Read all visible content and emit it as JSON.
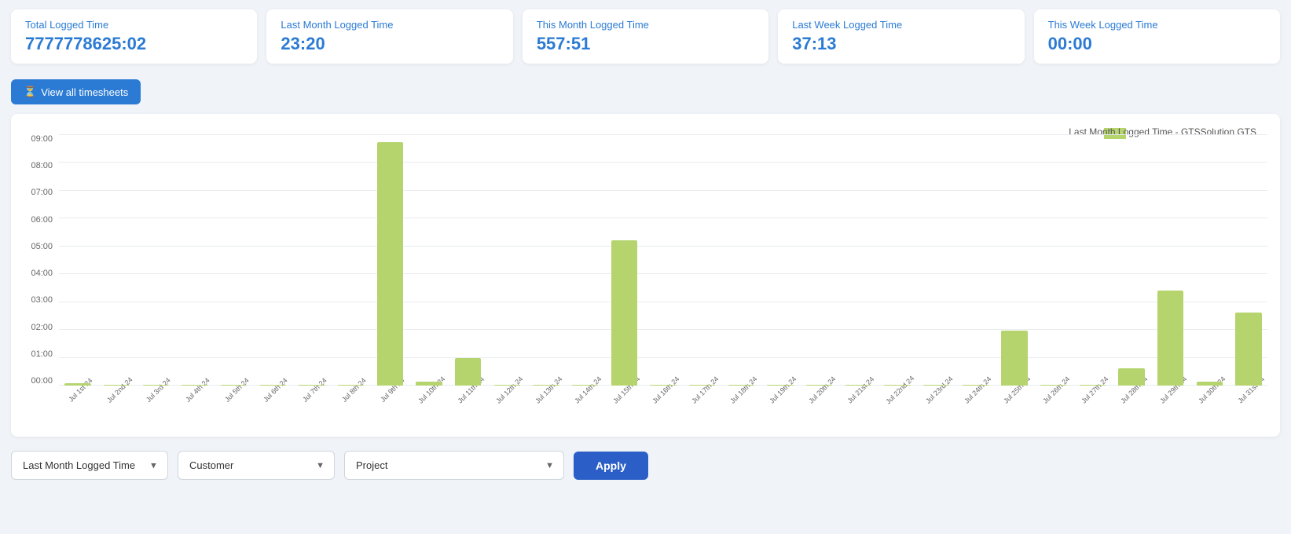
{
  "stats": [
    {
      "label": "Total Logged Time",
      "value": "7777778625:02"
    },
    {
      "label": "Last Month Logged Time",
      "value": "23:20"
    },
    {
      "label": "This Month Logged Time",
      "value": "557:51"
    },
    {
      "label": "Last Week Logged Time",
      "value": "37:13"
    },
    {
      "label": "This Week Logged Time",
      "value": "00:00"
    }
  ],
  "toolbar": {
    "view_all_label": "View all timesheets"
  },
  "chart": {
    "title": "Last Month Logged Time - GTSSolution GTS",
    "y_labels": [
      "09:00",
      "08:00",
      "07:00",
      "06:00",
      "05:00",
      "04:00",
      "03:00",
      "02:00",
      "01:00",
      "00:00"
    ],
    "bars": [
      {
        "label": "Jul 1st 24",
        "value": 0.8
      },
      {
        "label": "Jul 2nd 24",
        "value": 0
      },
      {
        "label": "Jul 3rd 24",
        "value": 0
      },
      {
        "label": "Jul 4th 24",
        "value": 0
      },
      {
        "label": "Jul 5th 24",
        "value": 0
      },
      {
        "label": "Jul 6th 24",
        "value": 0
      },
      {
        "label": "Jul 7th 24",
        "value": 0
      },
      {
        "label": "Jul 8th 24",
        "value": 0
      },
      {
        "label": "Jul 9th 24",
        "value": 97
      },
      {
        "label": "Jul 10th 24",
        "value": 1.5
      },
      {
        "label": "Jul 11th 24",
        "value": 11
      },
      {
        "label": "Jul 12th 24",
        "value": 0
      },
      {
        "label": "Jul 13th 24",
        "value": 0
      },
      {
        "label": "Jul 14th 24",
        "value": 0
      },
      {
        "label": "Jul 15th 24",
        "value": 58
      },
      {
        "label": "Jul 16th 24",
        "value": 0
      },
      {
        "label": "Jul 17th 24",
        "value": 0
      },
      {
        "label": "Jul 18th 24",
        "value": 0
      },
      {
        "label": "Jul 19th 24",
        "value": 0
      },
      {
        "label": "Jul 20th 24",
        "value": 0
      },
      {
        "label": "Jul 21st 24",
        "value": 0
      },
      {
        "label": "Jul 22nd 24",
        "value": 0
      },
      {
        "label": "Jul 23rd 24",
        "value": 0
      },
      {
        "label": "Jul 24th 24",
        "value": 0
      },
      {
        "label": "Jul 25th 24",
        "value": 22
      },
      {
        "label": "Jul 26th 24",
        "value": 0
      },
      {
        "label": "Jul 27th 24",
        "value": 0
      },
      {
        "label": "Jul 28th 24",
        "value": 7
      },
      {
        "label": "Jul 29th 24",
        "value": 38
      },
      {
        "label": "Jul 30th 24",
        "value": 1.5
      },
      {
        "label": "Jul 31st 24",
        "value": 29
      }
    ]
  },
  "controls": {
    "time_period_label": "Last Month Logged Time",
    "customer_label": "Customer",
    "project_label": "Project",
    "apply_label": "Apply"
  }
}
